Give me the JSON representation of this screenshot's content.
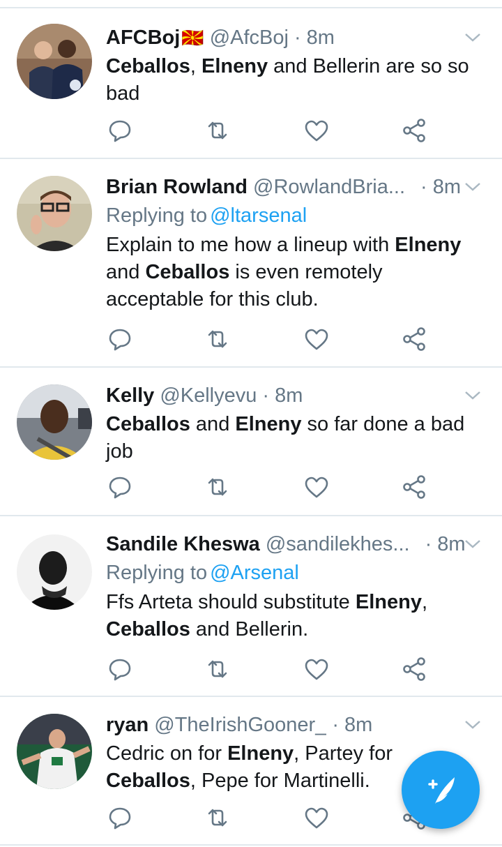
{
  "tweets": [
    {
      "name": "AFCBoj",
      "flag": "🇲🇰",
      "handle": "@AfcBoj",
      "separator": "·",
      "time": "8m",
      "replying_prefix": "",
      "replying_to": "",
      "text_segments": [
        {
          "t": "Ceballos",
          "bold": true
        },
        {
          "t": ", ",
          "bold": false
        },
        {
          "t": "Elneny",
          "bold": true
        },
        {
          "t": " and Bellerin are so so bad",
          "bold": false
        }
      ],
      "avatar": "two-men-photo"
    },
    {
      "name": "Brian Rowland",
      "handle": "@RowlandBria...",
      "separator": "·",
      "time": "8m",
      "replying_prefix": "Replying to",
      "replying_to": "@ltarsenal",
      "text_segments": [
        {
          "t": "Explain to me how a lineup with ",
          "bold": false
        },
        {
          "t": "Elneny",
          "bold": true
        },
        {
          "t": " and ",
          "bold": false
        },
        {
          "t": "Ceballos",
          "bold": true
        },
        {
          "t": " is even remotely acceptable for this club.",
          "bold": false
        }
      ],
      "avatar": "man-glasses-photo"
    },
    {
      "name": "Kelly",
      "handle": "@Kellyevu",
      "separator": "·",
      "time": "8m",
      "replying_prefix": "",
      "replying_to": "",
      "text_segments": [
        {
          "t": "Ceballos",
          "bold": true
        },
        {
          "t": " and ",
          "bold": false
        },
        {
          "t": "Elneny",
          "bold": true
        },
        {
          "t": " so far done a bad job",
          "bold": false
        }
      ],
      "avatar": "man-yellow-shirt-photo"
    },
    {
      "name": "Sandile Kheswa",
      "handle": "@sandilekhes...",
      "separator": "·",
      "time": "8m",
      "replying_prefix": "Replying to",
      "replying_to": "@Arsenal",
      "text_segments": [
        {
          "t": "Ffs Arteta should substitute ",
          "bold": false
        },
        {
          "t": "Elneny",
          "bold": true
        },
        {
          "t": ", ",
          "bold": false
        },
        {
          "t": "Ceballos",
          "bold": true
        },
        {
          "t": " and Bellerin.",
          "bold": false
        }
      ],
      "avatar": "man-bw-photo"
    },
    {
      "name": "ryan",
      "handle": "@TheIrishGooner_",
      "separator": "·",
      "time": "8m",
      "replying_prefix": "",
      "replying_to": "",
      "text_segments": [
        {
          "t": "Cedric on for ",
          "bold": false
        },
        {
          "t": "Elneny",
          "bold": true
        },
        {
          "t": ", Partey for ",
          "bold": false
        },
        {
          "t": "Ceballos",
          "bold": true
        },
        {
          "t": ", Pepe for Martinelli.",
          "bold": false
        }
      ],
      "avatar": "footballer-photo"
    }
  ],
  "icons": {
    "reply": "reply-icon",
    "retweet": "retweet-icon",
    "like": "heart-icon",
    "share": "share-icon",
    "caret": "chevron-down-icon",
    "compose": "compose-tweet-icon"
  },
  "colors": {
    "accent": "#1da1f2",
    "muted": "#657786",
    "text": "#14171a",
    "divider": "#e1e8ed"
  }
}
